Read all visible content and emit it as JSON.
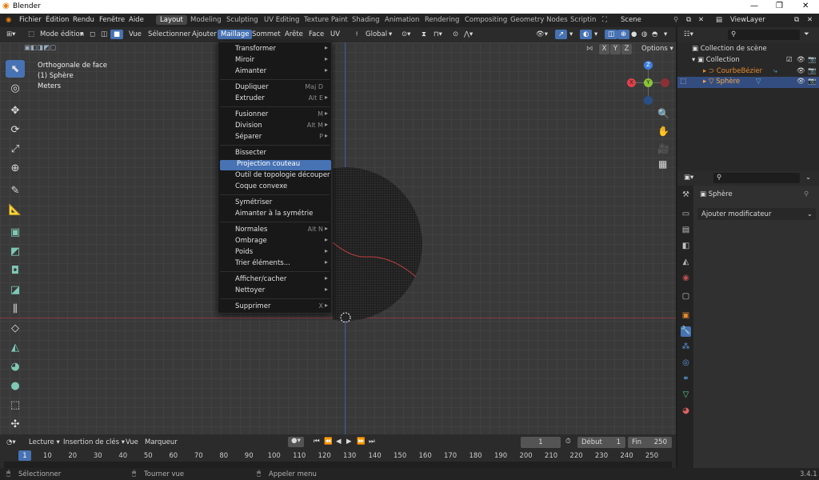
{
  "app": {
    "title": "Blender",
    "version": "3.4.1"
  },
  "menubar": [
    "Fichier",
    "Édition",
    "Rendu",
    "Fenêtre",
    "Aide"
  ],
  "workspaces": [
    "Layout",
    "Modeling",
    "Sculpting",
    "UV Editing",
    "Texture Paint",
    "Shading",
    "Animation",
    "Rendering",
    "Compositing",
    "Geometry Nodes",
    "Scriptin"
  ],
  "scene": "Scene",
  "view_layer": "ViewLayer",
  "viewport_header": {
    "mode": "Mode édition",
    "menus": [
      "Vue",
      "Sélectionner",
      "Ajouter",
      "Maillage",
      "Sommet",
      "Arête",
      "Face",
      "UV"
    ],
    "transform_orientation": "Global",
    "xyz": [
      "X",
      "Y",
      "Z"
    ],
    "options": "Options"
  },
  "overlay_text": {
    "view": "Orthogonale de face",
    "object": "(1) Sphère",
    "units": "Meters"
  },
  "mesh_menu": {
    "items": [
      {
        "label": "Transformer",
        "shortcut": "",
        "submenu": true
      },
      {
        "label": "Miroir",
        "shortcut": "",
        "submenu": true
      },
      {
        "label": "Aimanter",
        "shortcut": "",
        "submenu": true
      },
      {
        "label": "Dupliquer",
        "shortcut": "Maj D",
        "submenu": false
      },
      {
        "label": "Extruder",
        "shortcut": "Alt E",
        "submenu": true
      },
      {
        "label": "Fusionner",
        "shortcut": "M",
        "submenu": true
      },
      {
        "label": "Division",
        "shortcut": "Alt M",
        "submenu": true
      },
      {
        "label": "Séparer",
        "shortcut": "P",
        "submenu": true
      },
      {
        "label": "Bissecter",
        "shortcut": "",
        "submenu": false
      },
      {
        "label": "Projection couteau",
        "shortcut": "",
        "submenu": false
      },
      {
        "label": "Outil de topologie découper",
        "shortcut": "",
        "submenu": false
      },
      {
        "label": "Coque convexe",
        "shortcut": "",
        "submenu": false
      },
      {
        "label": "Symétriser",
        "shortcut": "",
        "submenu": false
      },
      {
        "label": "Aimanter à la symétrie",
        "shortcut": "",
        "submenu": false
      },
      {
        "label": "Normales",
        "shortcut": "Alt N",
        "submenu": true
      },
      {
        "label": "Ombrage",
        "shortcut": "",
        "submenu": true
      },
      {
        "label": "Poids",
        "shortcut": "",
        "submenu": true
      },
      {
        "label": "Trier éléments...",
        "shortcut": "",
        "submenu": true
      },
      {
        "label": "Afficher/cacher",
        "shortcut": "",
        "submenu": true
      },
      {
        "label": "Nettoyer",
        "shortcut": "",
        "submenu": true
      },
      {
        "label": "Supprimer",
        "shortcut": "X",
        "submenu": true
      }
    ],
    "highlighted": "Projection couteau"
  },
  "gizmo": {
    "x": "X",
    "y": "Y",
    "z": "Z"
  },
  "outliner": {
    "scene_collection": "Collection de scène",
    "items": [
      {
        "label": "Collection"
      },
      {
        "label": "CourbeBézier"
      },
      {
        "label": "Sphère"
      }
    ]
  },
  "properties": {
    "object": "Sphère",
    "add_modifier": "Ajouter modificateur"
  },
  "timeline": {
    "menus": [
      "Lecture",
      "Insertion de clés",
      "Vue",
      "Marqueur"
    ],
    "current_frame": "1",
    "start_label": "Début",
    "start": "1",
    "end_label": "Fin",
    "end": "250",
    "ruler": [
      "1",
      "10",
      "20",
      "30",
      "40",
      "50",
      "60",
      "70",
      "80",
      "90",
      "100",
      "110",
      "120",
      "130",
      "140",
      "150",
      "160",
      "170",
      "180",
      "190",
      "200",
      "210",
      "220",
      "230",
      "240",
      "250"
    ]
  },
  "statusbar": {
    "left": "Sélectionner",
    "middle": "Tourner vue",
    "right": "Appeler menu"
  },
  "colors": {
    "accent": "#4772b3",
    "x_axis": "#e0404a",
    "y_axis": "#8bc33a",
    "z_axis": "#3d7fe0",
    "orange": "#e58a2e"
  }
}
